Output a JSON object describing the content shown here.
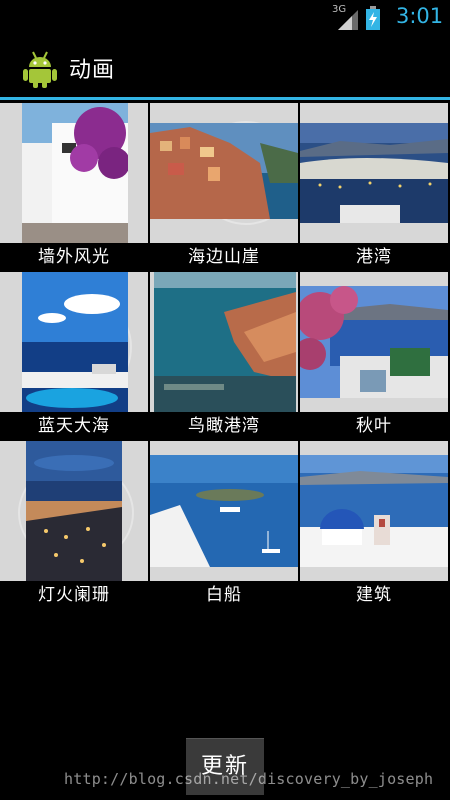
{
  "status_bar": {
    "network_label": "3G",
    "time": "3:01",
    "clock_color": "#33b5e5",
    "icons": [
      "signal-icon",
      "battery-charging-icon"
    ]
  },
  "action_bar": {
    "app_icon": "android-robot-icon",
    "title": "动画",
    "accent_color": "#33b5e5"
  },
  "gallery": [
    {
      "caption": "墙外风光"
    },
    {
      "caption": "海边山崖"
    },
    {
      "caption": "港湾"
    },
    {
      "caption": "蓝天大海"
    },
    {
      "caption": "鸟瞰港湾"
    },
    {
      "caption": "秋叶"
    },
    {
      "caption": "灯火阑珊"
    },
    {
      "caption": "白船"
    },
    {
      "caption": "建筑"
    }
  ],
  "update_button_label": "更新",
  "watermark": "http://blog.csdn.net/discovery_by_joseph"
}
